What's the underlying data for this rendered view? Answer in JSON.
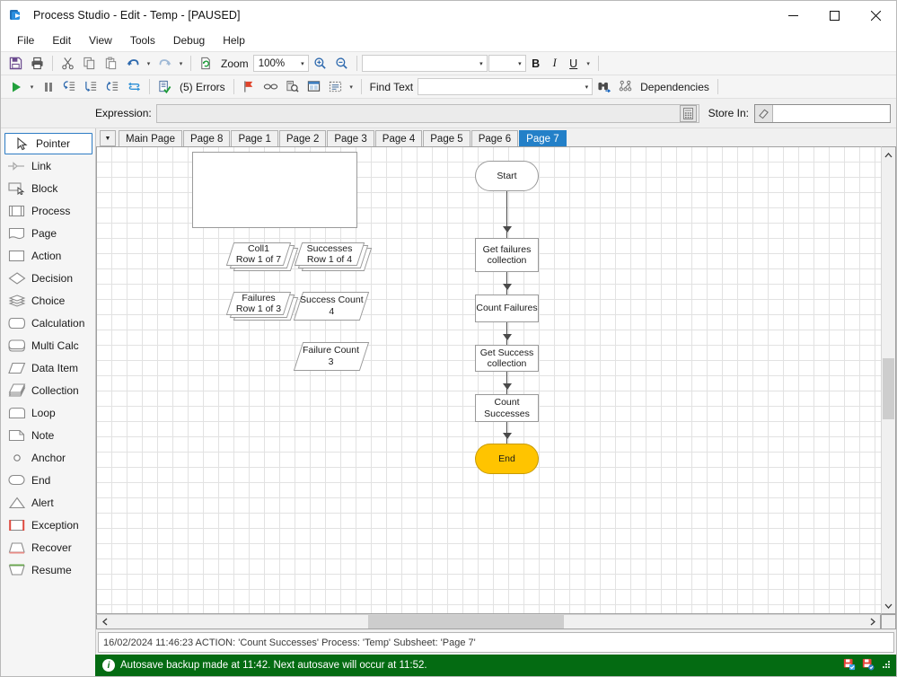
{
  "window": {
    "title": "Process Studio  - Edit - Temp - [PAUSED]",
    "icon": "process-studio-icon",
    "minimize": "—",
    "maximize": "☐",
    "close": "✕"
  },
  "menu": {
    "items": [
      "File",
      "Edit",
      "View",
      "Tools",
      "Debug",
      "Help"
    ]
  },
  "toolbar_top": {
    "save_icon": "save-icon",
    "print_icon": "print-icon",
    "cut_icon": "cut-icon",
    "copy_icon": "copy-icon",
    "paste_icon": "paste-icon",
    "undo_icon": "undo-icon",
    "redo_icon": "redo-icon",
    "refresh_icon": "refresh-page-icon",
    "zoom_label": "Zoom",
    "zoom_value": "100%",
    "zoom_in_icon": "zoom-in-icon",
    "zoom_out_icon": "zoom-out-icon",
    "font_value": "",
    "font_size_value": "",
    "bold_label": "B",
    "italic_label": "I",
    "underline_label": "U"
  },
  "toolbar_debug": {
    "run_icon": "run-play-icon",
    "pause_icon": "pause-icon",
    "step_icon": "step-into-icon",
    "step_over_icon": "step-over-icon",
    "step_out_icon": "step-out-icon",
    "reset_icon": "reset-icon",
    "validate_icon": "validate-icon",
    "errors_label": "(5) Errors",
    "breakpoint_icon": "breakpoint-flag-icon",
    "link_icon": "chain-link-icon",
    "search_process_icon": "search-process-icon",
    "panel_icon": "panel-icon",
    "select_icon": "select-all-icon",
    "find_text_label": "Find Text",
    "find_text_value": "",
    "binoculars_icon": "binoculars-find-icon",
    "dependencies_icon": "dependencies-icon",
    "dependencies_label": "Dependencies"
  },
  "expression": {
    "label": "Expression:",
    "value": "",
    "calculator_icon": "calculator-icon",
    "store_label": "Store In:",
    "store_value": "",
    "store_icon": "eraser-icon"
  },
  "palette": {
    "items": [
      {
        "label": "Pointer",
        "icon": "cursor-pointer-icon",
        "selected": true
      },
      {
        "label": "Link",
        "icon": "link-icon",
        "selected": false
      },
      {
        "label": "Block",
        "icon": "block-icon",
        "selected": false
      },
      {
        "label": "Process",
        "icon": "process-icon",
        "selected": false
      },
      {
        "label": "Page",
        "icon": "page-icon",
        "selected": false
      },
      {
        "label": "Action",
        "icon": "action-icon",
        "selected": false
      },
      {
        "label": "Decision",
        "icon": "decision-diamond-icon",
        "selected": false
      },
      {
        "label": "Choice",
        "icon": "choice-stack-icon",
        "selected": false
      },
      {
        "label": "Calculation",
        "icon": "calculation-icon",
        "selected": false
      },
      {
        "label": "Multi Calc",
        "icon": "multi-calc-icon",
        "selected": false
      },
      {
        "label": "Data Item",
        "icon": "data-item-icon",
        "selected": false
      },
      {
        "label": "Collection",
        "icon": "collection-icon",
        "selected": false
      },
      {
        "label": "Loop",
        "icon": "loop-icon",
        "selected": false
      },
      {
        "label": "Note",
        "icon": "note-icon",
        "selected": false
      },
      {
        "label": "Anchor",
        "icon": "anchor-circle-icon",
        "selected": false
      },
      {
        "label": "End",
        "icon": "end-icon",
        "selected": false
      },
      {
        "label": "Alert",
        "icon": "alert-triangle-icon",
        "selected": false
      },
      {
        "label": "Exception",
        "icon": "exception-icon",
        "selected": false
      },
      {
        "label": "Recover",
        "icon": "recover-icon",
        "selected": false
      },
      {
        "label": "Resume",
        "icon": "resume-icon",
        "selected": false
      }
    ]
  },
  "tabs": {
    "dropdown_icon": "chevron-down-icon",
    "items": [
      {
        "label": "Main Page",
        "active": false
      },
      {
        "label": "Page 8",
        "active": false
      },
      {
        "label": "Page 1",
        "active": false
      },
      {
        "label": "Page 2",
        "active": false
      },
      {
        "label": "Page 3",
        "active": false
      },
      {
        "label": "Page 4",
        "active": false
      },
      {
        "label": "Page 5",
        "active": false
      },
      {
        "label": "Page 6",
        "active": false
      },
      {
        "label": "Page 7",
        "active": true
      }
    ]
  },
  "diagram": {
    "flow_nodes": [
      {
        "id": "start",
        "label": "Start",
        "type": "terminal"
      },
      {
        "id": "get-failures",
        "label": "Get failures collection",
        "type": "action"
      },
      {
        "id": "count-failures",
        "label": "Count Failures",
        "type": "action"
      },
      {
        "id": "get-success",
        "label": "Get Success collection",
        "type": "action"
      },
      {
        "id": "count-success",
        "label": "Count Successes",
        "type": "action"
      },
      {
        "id": "end",
        "label": "End",
        "type": "end"
      }
    ],
    "collections": [
      {
        "id": "coll1",
        "name": "Coll1",
        "detail": "Row 1 of 7"
      },
      {
        "id": "successes",
        "name": "Successes",
        "detail": "Row 1 of 4"
      },
      {
        "id": "failures",
        "name": "Failures",
        "detail": "Row 1 of 3"
      }
    ],
    "data_items": [
      {
        "id": "success-count",
        "name": "Success Count",
        "value": "4"
      },
      {
        "id": "failure-count",
        "name": "Failure Count",
        "value": "3"
      }
    ],
    "note": {
      "id": "note-blank",
      "text": ""
    }
  },
  "log": {
    "entry": "16/02/2024 11:46:23 ACTION: 'Count Successes' Process: 'Temp' Subsheet: 'Page 7'"
  },
  "status": {
    "icon": "info-icon",
    "message": "Autosave backup made at 11:42. Next autosave will occur at 11:52.",
    "tray_icons": [
      "save-status-icon",
      "connection-status-icon",
      "resize-grip-icon"
    ]
  },
  "colors": {
    "accent": "#2380c8",
    "status_bar": "#046b12",
    "end_node": "#ffc400",
    "exception_red": "#e04a3f",
    "recover_red": "#e88a84",
    "resume_green": "#6aa84f"
  },
  "scroll": {
    "up_icon": "chevron-up-icon",
    "down_icon": "chevron-down-icon",
    "left_icon": "chevron-left-icon",
    "right_icon": "chevron-right-icon"
  }
}
